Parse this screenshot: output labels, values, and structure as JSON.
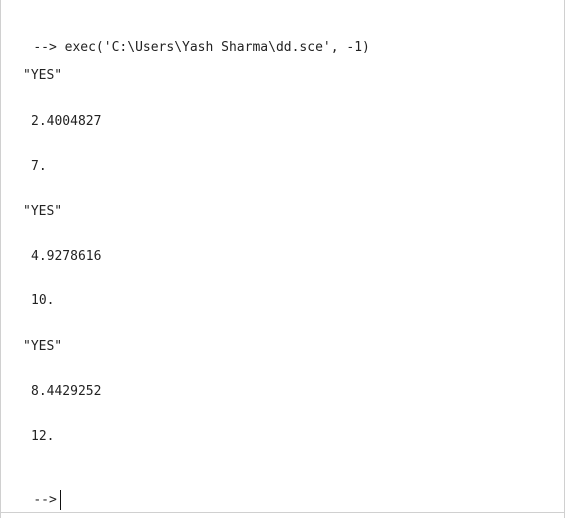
{
  "console": {
    "command_prompt": "-->",
    "command": "exec('C:\\Users\\Yash Sharma\\dd.sce', -1)",
    "outputs": [
      {
        "text": "\"YES\""
      },
      {
        "text": "2.4004827"
      },
      {
        "text": "7."
      },
      {
        "text": "\"YES\""
      },
      {
        "text": "4.9278616"
      },
      {
        "text": "10."
      },
      {
        "text": "\"YES\""
      },
      {
        "text": "8.4429252"
      },
      {
        "text": "12."
      }
    ],
    "final_prompt": "-->"
  }
}
